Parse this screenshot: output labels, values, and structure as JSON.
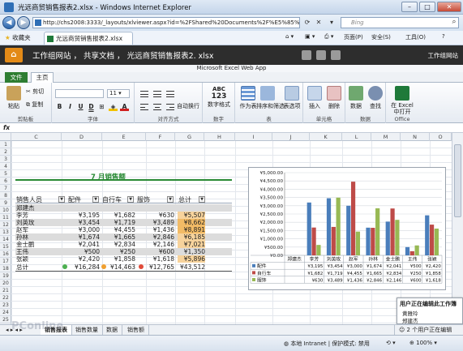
{
  "window": {
    "title": "光远商贸销售报表2.xlsx - Windows Internet Explorer",
    "minimize": "–",
    "maximize": "□",
    "close": "✕"
  },
  "addressbar": {
    "back": "◀",
    "forward": "▶",
    "url": "http://chs2008:3333/_layouts/xlviewer.aspx?id=%2FShared%20Documents%2F%E5%85%89%E8%BF%9C",
    "search_placeholder": "Bing"
  },
  "favbar": {
    "favorites": "收藏夹",
    "tab_title": "光远商贸销售报表2.xlsx",
    "page_menu": "页面(P)",
    "safety_menu": "安全(S)",
    "tools_menu": "工具(O)",
    "help_menu": "?"
  },
  "app_header": {
    "breadcrumb": "工作组网站 ， 共享文档 ， 光远商贸销售报表2. xlsx",
    "site_label": "工作组网站",
    "webapp": "Microsoft Excel Web App"
  },
  "ribbon": {
    "tabs": [
      "文件",
      "主页"
    ],
    "paste": "粘贴",
    "cut": "剪切",
    "copy": "复制",
    "clipboard": "剪贴板",
    "font_size": "11",
    "font_group": "字体",
    "bold": "B",
    "italic": "I",
    "underline": "U",
    "dunder": "D",
    "wrap": "自动换行",
    "align_group": "对齐方式",
    "number_format": "数字格式",
    "abc": "ABC",
    "n123": "123",
    "number_group": "数字",
    "as_table": "作为表",
    "sort_filter": "排序和筛选",
    "table_options": "表选项",
    "table_group": "表",
    "insert": "插入",
    "delete": "删除",
    "cells_group": "单元格",
    "data": "数据",
    "find": "查找",
    "data_group": "数据",
    "open_in_excel": "在 Excel 中打开",
    "office_group": "Office"
  },
  "formula": {
    "fx": "fx",
    "value": ""
  },
  "columns": [
    "C",
    "D",
    "E",
    "F",
    "G",
    "H",
    "I",
    "J",
    "K",
    "L",
    "M",
    "N",
    "O"
  ],
  "rows": [
    "1",
    "2",
    "3",
    "4",
    "5",
    "6",
    "7",
    "8",
    "9",
    "10",
    "11",
    "12",
    "13",
    "14",
    "15",
    "16",
    "17",
    "18",
    "19",
    "20",
    "21",
    "22",
    "23",
    "24",
    "25"
  ],
  "table": {
    "title": "7 月销售额",
    "headers": [
      "销售人员",
      "配件",
      "自行车",
      "服饰",
      "总计"
    ],
    "rows": [
      {
        "name": "郑建杰",
        "a": "",
        "b": "",
        "c": "",
        "t": ""
      },
      {
        "name": "李芳",
        "a": "¥3,195",
        "b": "¥1,682",
        "c": "¥630",
        "t": "¥5,507"
      },
      {
        "name": "刘英玫",
        "a": "¥3,454",
        "b": "¥1,719",
        "c": "¥3,489",
        "t": "¥8,662"
      },
      {
        "name": "赵军",
        "a": "¥3,000",
        "b": "¥4,455",
        "c": "¥1,436",
        "t": "¥8,891"
      },
      {
        "name": "孙林",
        "a": "¥1,674",
        "b": "¥1,665",
        "c": "¥2,846",
        "t": "¥6,185"
      },
      {
        "name": "金士鹏",
        "a": "¥2,041",
        "b": "¥2,834",
        "c": "¥2,146",
        "t": "¥7,021"
      },
      {
        "name": "王伟",
        "a": "¥500",
        "b": "¥250",
        "c": "¥600",
        "t": "¥1,350"
      },
      {
        "name": "张颖",
        "a": "¥2,420",
        "b": "¥1,858",
        "c": "¥1,618",
        "t": "¥5,896"
      }
    ],
    "total": {
      "name": "总计",
      "a": "¥16,284",
      "b": "¥14,463",
      "c": "¥12,765",
      "t": "¥43,512"
    }
  },
  "chart_data": {
    "type": "bar",
    "categories": [
      "郑建杰",
      "李芳",
      "刘英玫",
      "赵军",
      "孙林",
      "金士鹏",
      "王伟",
      "张颖"
    ],
    "series": [
      {
        "name": "配件",
        "color": "#4a7ebb",
        "values": [
          0,
          3195,
          3454,
          3000,
          1674,
          2041,
          500,
          2420
        ],
        "labels": [
          "",
          "¥3,195",
          "¥3,454",
          "¥3,000",
          "¥1,674",
          "¥2,041",
          "¥500",
          "¥2,420"
        ]
      },
      {
        "name": "自行车",
        "color": "#be4b48",
        "values": [
          0,
          1682,
          1719,
          4455,
          1665,
          2834,
          250,
          1858
        ],
        "labels": [
          "",
          "¥1,682",
          "¥1,719",
          "¥4,455",
          "¥1,665",
          "¥2,834",
          "¥250",
          "¥1,858"
        ]
      },
      {
        "name": "服饰",
        "color": "#98b954",
        "values": [
          0,
          630,
          3489,
          1436,
          2846,
          2146,
          600,
          1618
        ],
        "labels": [
          "",
          "¥630",
          "¥3,489",
          "¥1,436",
          "¥2,846",
          "¥2,146",
          "¥600",
          "¥1,618"
        ]
      }
    ],
    "yticks": [
      "¥0.00",
      "¥500.00",
      "¥1,000.00",
      "¥1,500.00",
      "¥2,000.00",
      "¥2,500.00",
      "¥3,000.00",
      "¥3,500.00",
      "¥4,000.00",
      "¥4,500.00",
      "¥5,000.00"
    ],
    "ylim": [
      0,
      5000
    ],
    "grid": true,
    "legend": "data-table"
  },
  "edit_pane": {
    "title": "用户正在编辑此工作簿",
    "users": [
      "黄雅玲",
      "郑建杰"
    ]
  },
  "sheet_tabs": [
    "销售报表",
    "销售数量",
    "数据",
    "销售额"
  ],
  "status": {
    "editing": "2 个用户正在编辑",
    "zone": "本地 Intranet | 保护模式: 禁用",
    "zoom": "100%"
  },
  "watermark": "PConline"
}
